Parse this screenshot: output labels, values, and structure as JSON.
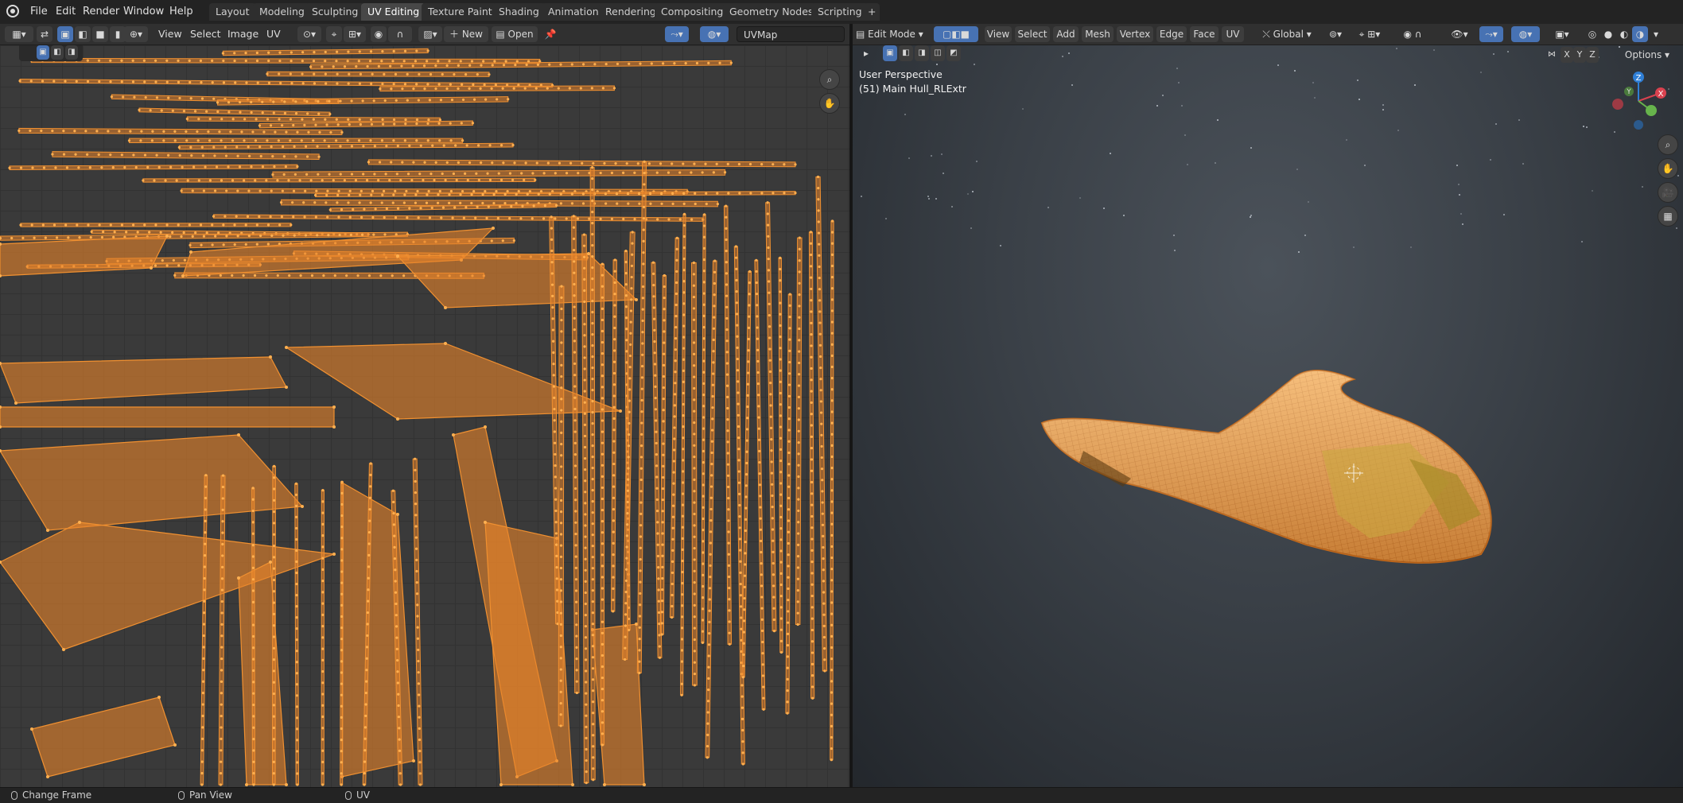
{
  "menus": [
    "File",
    "Edit",
    "Render",
    "Window",
    "Help"
  ],
  "workspaces": [
    "Layout",
    "Modeling",
    "Sculpting",
    "UV Editing",
    "Texture Paint",
    "Shading",
    "Animation",
    "Rendering",
    "Compositing",
    "Geometry Nodes",
    "Scripting"
  ],
  "active_workspace": "UV Editing",
  "add_tab": "+",
  "uv_header": {
    "view": "View",
    "select": "Select",
    "image": "Image",
    "uv": "UV",
    "new_label": "New",
    "open_label": "Open",
    "uvmap": "UVMap"
  },
  "vp_header": {
    "mode": "Edit Mode",
    "view": "View",
    "select": "Select",
    "add": "Add",
    "mesh": "Mesh",
    "vertex": "Vertex",
    "edge": "Edge",
    "face": "Face",
    "uv": "UV",
    "orientation": "Global",
    "axis_x": "X",
    "axis_y": "Y",
    "axis_z": "Z",
    "options": "Options"
  },
  "viewport": {
    "perspective": "User Perspective",
    "object": "(51) Main Hull_RLExtr"
  },
  "gizmo": {
    "x": "X",
    "y": "Y",
    "z": "Z"
  },
  "status": {
    "left": "Change Frame",
    "middle": "Pan View",
    "right": "UV"
  },
  "colors": {
    "accent": "#4772b3",
    "uv_island": "#e8832a",
    "selected_orange": "#f5a040"
  },
  "icons": [
    "blender-icon",
    "image-editor-icon",
    "sync-icon",
    "vertex-select-icon",
    "edge-select-icon",
    "face-select-icon",
    "island-select-icon",
    "pivot-icon",
    "snap-icon",
    "proportional-icon",
    "pin-icon",
    "zoom-icon",
    "hand-icon",
    "camera-icon",
    "grid-icon"
  ]
}
